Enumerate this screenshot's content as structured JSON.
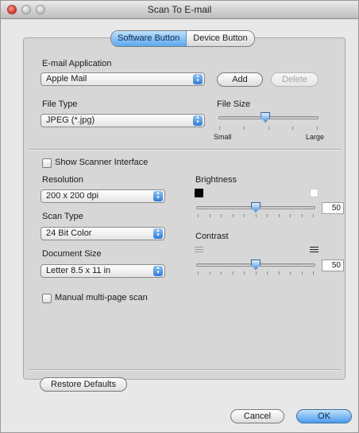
{
  "window": {
    "title": "Scan To E-mail"
  },
  "tabs": {
    "software": "Software Button",
    "device": "Device Button"
  },
  "email": {
    "label": "E-mail Application",
    "value": "Apple Mail",
    "add": "Add",
    "delete": "Delete"
  },
  "file_type": {
    "label": "File Type",
    "value": "JPEG (*.jpg)"
  },
  "file_size": {
    "label": "File Size",
    "min_label": "Small",
    "max_label": "Large",
    "level": 0.47
  },
  "scanner": {
    "show_interface": "Show Scanner Interface",
    "checked": false
  },
  "resolution": {
    "label": "Resolution",
    "value": "200 x 200 dpi"
  },
  "scan_type": {
    "label": "Scan Type",
    "value": "24 Bit Color"
  },
  "doc_size": {
    "label": "Document Size",
    "value": "Letter  8.5 x 11 in"
  },
  "manual": {
    "label": "Manual multi-page scan",
    "checked": false
  },
  "brightness": {
    "label": "Brightness",
    "value": "50",
    "level": 0.5
  },
  "contrast": {
    "label": "Contrast",
    "value": "50",
    "level": 0.5
  },
  "footer": {
    "restore": "Restore Defaults",
    "cancel": "Cancel",
    "ok": "OK"
  },
  "colors": {
    "accent": "#4a9cee",
    "panel": "#d7d7d7",
    "window": "#e8e8e8"
  }
}
